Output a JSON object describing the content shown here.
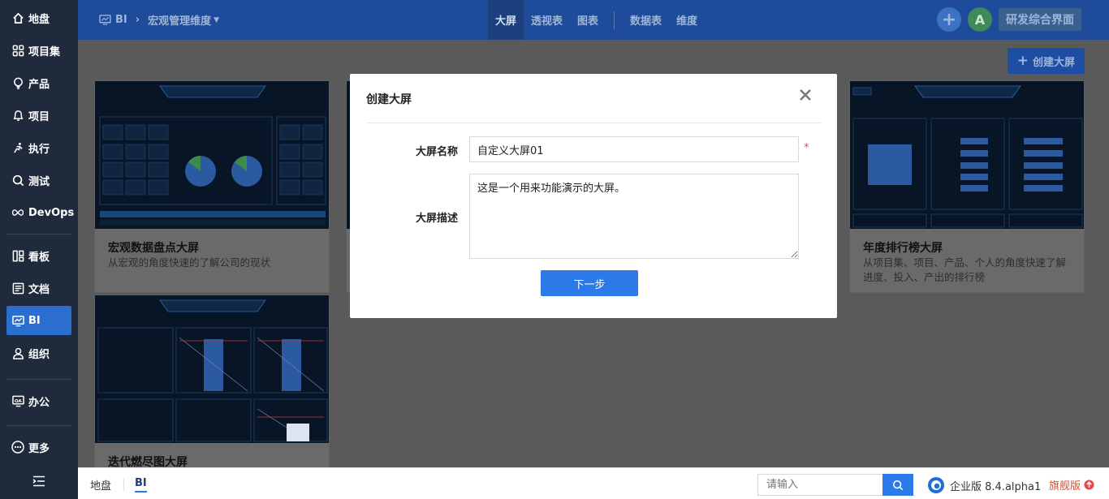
{
  "sidebar": {
    "items": [
      {
        "label": "地盘",
        "icon": "home-icon"
      },
      {
        "label": "项目集",
        "icon": "grid-icon"
      },
      {
        "label": "产品",
        "icon": "bulb-icon"
      },
      {
        "label": "项目",
        "icon": "bell-icon"
      },
      {
        "label": "执行",
        "icon": "run-icon"
      },
      {
        "label": "测试",
        "icon": "search-test-icon"
      },
      {
        "label": "DevOps",
        "icon": "infinity-icon"
      },
      {
        "label": "看板",
        "icon": "kanban-icon"
      },
      {
        "label": "文档",
        "icon": "doc-icon"
      },
      {
        "label": "BI",
        "icon": "monitor-icon"
      },
      {
        "label": "组织",
        "icon": "user-icon"
      },
      {
        "label": "办公",
        "icon": "office-icon"
      },
      {
        "label": "更多",
        "icon": "more-icon"
      }
    ],
    "active": "BI"
  },
  "header": {
    "app": "BI",
    "dimension": "宏观管理维度",
    "tabs": [
      "大屏",
      "透视表",
      "图表",
      "数据表",
      "维度"
    ],
    "active_tab": "大屏",
    "avatar": "A",
    "workspace": "研发综合界面"
  },
  "main": {
    "create_button": "创建大屏",
    "cards": [
      {
        "title": "宏观数据盘点大屏",
        "desc": "从宏观的角度快速的了解公司的现状"
      },
      {
        "title": "年度排行榜大屏",
        "desc": "从项目集、项目、产品、个人的角度快速了解进度、投入、产出的排行榜"
      },
      {
        "title": "迭代燃尽图大屏",
        "desc": ""
      }
    ]
  },
  "modal": {
    "title": "创建大屏",
    "name_label": "大屏名称",
    "name_value": "自定义大屏01",
    "required_mark": "*",
    "desc_label": "大屏描述",
    "desc_value": "这是一个用来功能演示的大屏。",
    "next_button": "下一步"
  },
  "footer": {
    "tabs": [
      "地盘",
      "BI"
    ],
    "active_tab": "BI",
    "search_placeholder": "请输入",
    "edition": "企业版 8.4.alpha1",
    "flagship": "旗舰版"
  },
  "colors": {
    "sidebar_bg": "#1f2a3d",
    "header_bg": "#1f4c9a",
    "accent": "#2b7ae8",
    "required": "#e34a4a"
  }
}
